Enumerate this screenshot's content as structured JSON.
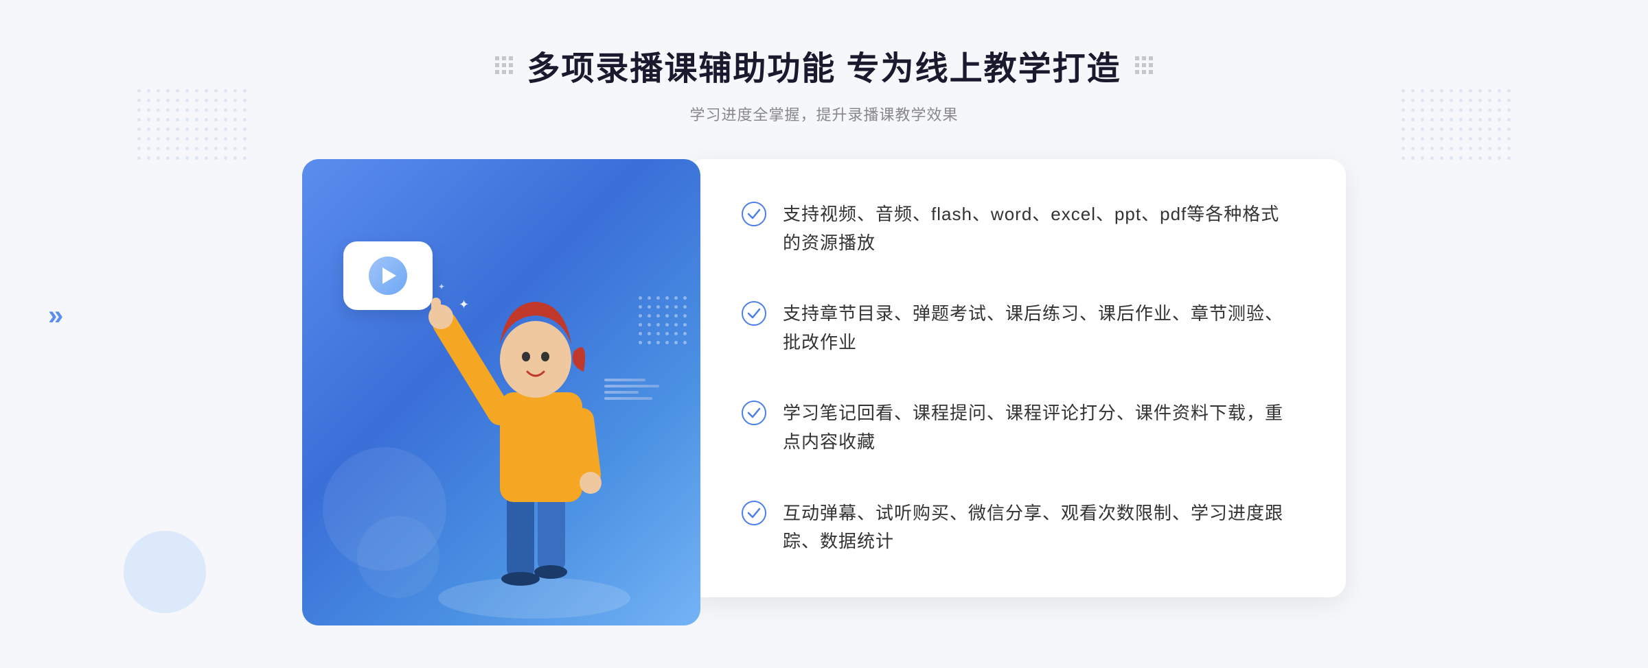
{
  "header": {
    "grid_icon_left": "grid-decoration",
    "grid_icon_right": "grid-decoration",
    "main_title": "多项录播课辅助功能 专为线上教学打造",
    "sub_title": "学习进度全掌握，提升录播课教学效果"
  },
  "features": [
    {
      "id": 1,
      "text": "支持视频、音频、flash、word、excel、ppt、pdf等各种格式的资源播放"
    },
    {
      "id": 2,
      "text": "支持章节目录、弹题考试、课后练习、课后作业、章节测验、批改作业"
    },
    {
      "id": 3,
      "text": "学习笔记回看、课程提问、课程评论打分、课件资料下载，重点内容收藏"
    },
    {
      "id": 4,
      "text": "互动弹幕、试听购买、微信分享、观看次数限制、学习进度跟踪、数据统计"
    }
  ],
  "colors": {
    "primary_blue": "#4a7ee8",
    "light_blue": "#a0c4f8",
    "bg": "#f5f7fa",
    "text_dark": "#1a1a2e",
    "text_gray": "#888888",
    "text_feature": "#333333"
  },
  "decoration": {
    "arrows_left": "»",
    "play_button": "▶"
  }
}
